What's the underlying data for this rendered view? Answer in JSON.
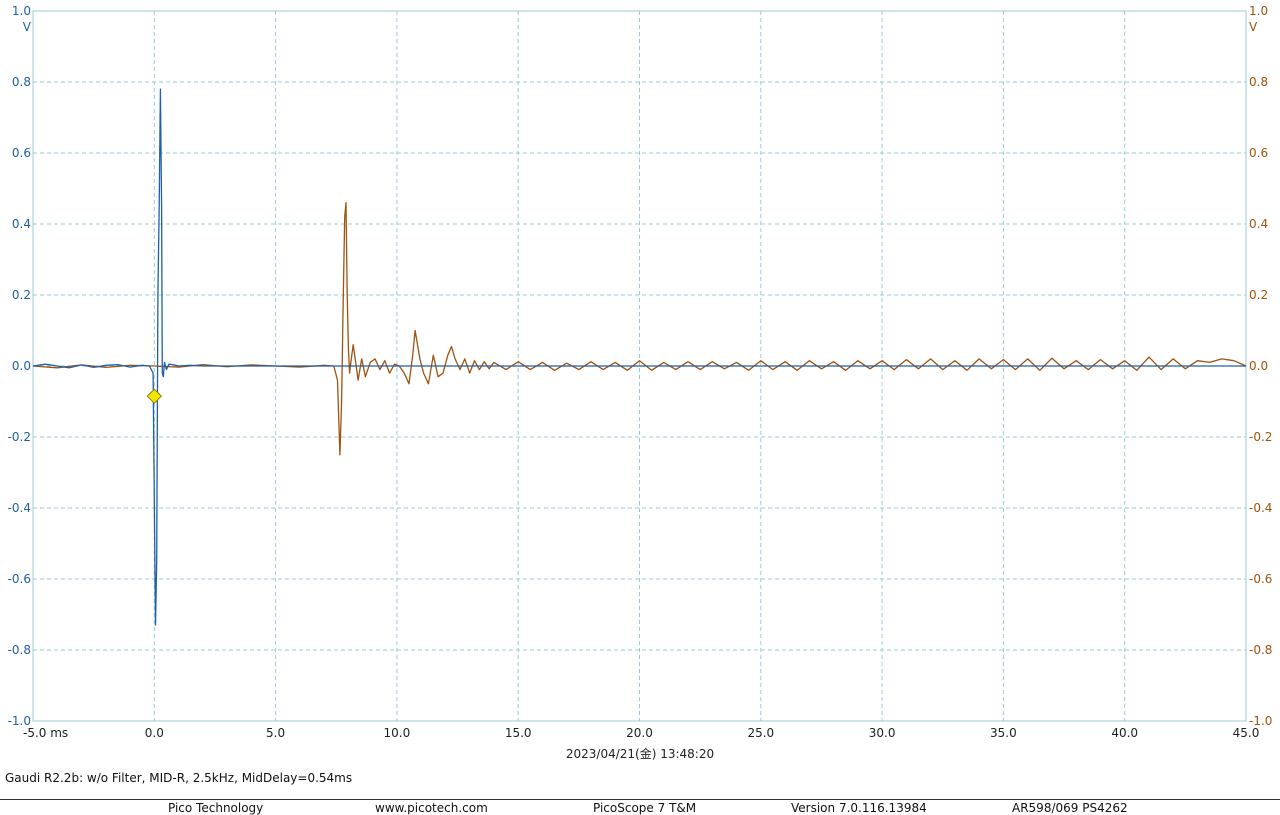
{
  "chart_data": {
    "type": "line",
    "x_tick_labels": [
      "-5.0 ms",
      "0.0",
      "5.0",
      "10.0",
      "15.0",
      "20.0",
      "25.0",
      "30.0",
      "35.0",
      "40.0",
      "45.0"
    ],
    "y_tick_labels": [
      "1.0",
      "0.8",
      "0.6",
      "0.4",
      "0.2",
      "0.0",
      "-0.2",
      "-0.4",
      "-0.6",
      "-0.8",
      "-1.0"
    ],
    "y_unit_left": "V",
    "y_unit_right": "V",
    "xlim": [
      -5,
      45
    ],
    "ylim": [
      -1,
      1
    ],
    "grid": true,
    "timestamp": "2023/04/21(金) 13:48:20",
    "trigger_marker": {
      "x": 0.0,
      "y": -0.085,
      "color": "#f2e600"
    },
    "series": [
      {
        "color": "#1f5fa8",
        "axis": "left",
        "x": [
          -5.0,
          -4.5,
          -4.0,
          -3.5,
          -3.0,
          -2.5,
          -2.0,
          -1.5,
          -1.0,
          -0.5,
          -0.2,
          -0.05,
          0.05,
          0.1,
          0.15,
          0.2,
          0.25,
          0.3,
          0.33,
          0.37,
          0.42,
          0.5,
          0.6,
          0.8,
          1.0,
          1.5,
          2.0,
          3.0,
          5.0,
          10.0,
          20.0,
          30.0,
          40.0,
          45.0
        ],
        "y": [
          0.0,
          0.005,
          0.0,
          -0.005,
          0.003,
          -0.004,
          0.002,
          0.004,
          -0.003,
          0.002,
          0.0,
          -0.02,
          -0.73,
          -0.55,
          0.2,
          0.45,
          0.78,
          0.45,
          -0.02,
          -0.03,
          0.01,
          -0.01,
          0.005,
          0.003,
          0.0,
          0.002,
          0.0,
          0.0,
          0.0,
          0.0,
          0.0,
          0.0,
          0.0,
          0.0
        ]
      },
      {
        "color": "#a0520f",
        "axis": "right",
        "x": [
          -5.0,
          -4.0,
          -3.0,
          -2.0,
          -1.0,
          0.0,
          1.0,
          2.0,
          3.0,
          4.0,
          5.0,
          6.0,
          7.0,
          7.4,
          7.55,
          7.65,
          7.72,
          7.78,
          7.85,
          7.9,
          7.95,
          8.0,
          8.05,
          8.12,
          8.2,
          8.3,
          8.4,
          8.55,
          8.7,
          8.9,
          9.1,
          9.3,
          9.5,
          9.7,
          9.9,
          10.1,
          10.3,
          10.5,
          10.65,
          10.75,
          10.85,
          10.95,
          11.1,
          11.3,
          11.5,
          11.7,
          11.9,
          12.1,
          12.25,
          12.4,
          12.6,
          12.8,
          13.0,
          13.2,
          13.4,
          13.6,
          13.8,
          14.0,
          14.5,
          15.0,
          15.5,
          16.0,
          16.5,
          17.0,
          17.5,
          18.0,
          18.5,
          19.0,
          19.5,
          20.0,
          20.5,
          21.0,
          21.5,
          22.0,
          22.5,
          23.0,
          23.5,
          24.0,
          24.5,
          25.0,
          25.5,
          26.0,
          26.5,
          27.0,
          27.5,
          28.0,
          28.5,
          29.0,
          29.5,
          30.0,
          30.5,
          31.0,
          31.5,
          32.0,
          32.5,
          33.0,
          33.5,
          34.0,
          34.5,
          35.0,
          35.5,
          36.0,
          36.5,
          37.0,
          37.5,
          38.0,
          38.5,
          39.0,
          39.5,
          40.0,
          40.5,
          41.0,
          41.5,
          42.0,
          42.5,
          43.0,
          43.5,
          44.0,
          44.5,
          45.0
        ],
        "y": [
          0.0,
          -0.005,
          0.003,
          -0.004,
          0.002,
          0.0,
          -0.003,
          0.004,
          -0.002,
          0.003,
          0.0,
          -0.003,
          0.002,
          0.0,
          -0.04,
          -0.25,
          -0.1,
          0.15,
          0.42,
          0.46,
          0.2,
          0.05,
          -0.02,
          0.02,
          0.06,
          0.01,
          -0.04,
          0.02,
          -0.03,
          0.01,
          0.02,
          -0.01,
          0.015,
          -0.02,
          0.005,
          0.0,
          -0.02,
          -0.05,
          0.03,
          0.1,
          0.06,
          0.02,
          -0.02,
          -0.05,
          0.03,
          -0.03,
          -0.02,
          0.03,
          0.055,
          0.02,
          -0.01,
          0.02,
          -0.02,
          0.015,
          -0.01,
          0.012,
          -0.008,
          0.01,
          -0.01,
          0.012,
          -0.01,
          0.01,
          -0.012,
          0.008,
          -0.01,
          0.012,
          -0.01,
          0.01,
          -0.012,
          0.015,
          -0.012,
          0.01,
          -0.01,
          0.012,
          -0.01,
          0.012,
          -0.008,
          0.01,
          -0.012,
          0.015,
          -0.01,
          0.012,
          -0.012,
          0.015,
          -0.008,
          0.012,
          -0.012,
          0.015,
          -0.008,
          0.015,
          -0.01,
          0.018,
          -0.008,
          0.02,
          -0.01,
          0.015,
          -0.012,
          0.02,
          -0.008,
          0.018,
          -0.01,
          0.02,
          -0.012,
          0.022,
          -0.008,
          0.015,
          -0.01,
          0.018,
          -0.008,
          0.015,
          -0.012,
          0.025,
          -0.01,
          0.02,
          -0.008,
          0.015,
          0.01,
          0.02,
          0.015,
          0.0
        ]
      }
    ]
  },
  "caption": "Gaudi R2.2b: w/o Filter, MID-R, 2.5kHz, MidDelay=0.54ms",
  "footer": {
    "company": "Pico Technology",
    "website": "www.picotech.com",
    "product": "PicoScope 7 T&M",
    "version": "Version 7.0.116.13984",
    "device": "AR598/069 PS4262"
  },
  "colors": {
    "grid": "#9ccbd8",
    "left_axis_text": "#1f5fa8",
    "right_axis_text": "#a0520f",
    "axis_frame": "#333333"
  }
}
